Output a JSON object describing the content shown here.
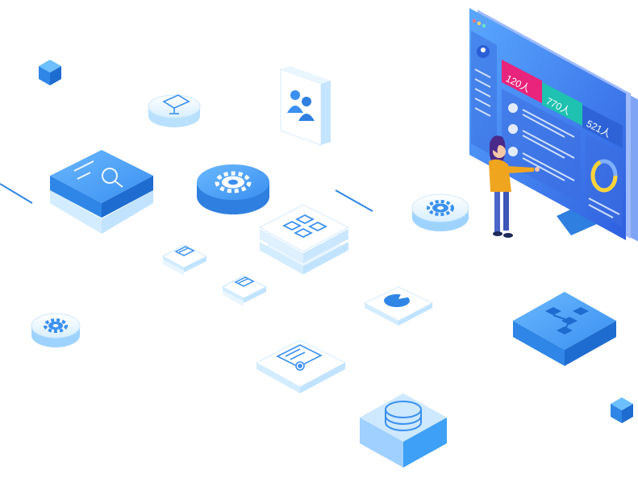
{
  "dashboard": {
    "stat_cards": [
      {
        "value": "120人",
        "color": "#e8247c"
      },
      {
        "value": "770人",
        "color": "#1fc1b0"
      },
      {
        "value": "521人",
        "color": "#2e63d8"
      }
    ],
    "ring_fill": 0.7
  },
  "palette": {
    "primary": "#3a8ff0",
    "primary_dark": "#1f6fd6",
    "light": "#dff2ff",
    "ice": "#eaf6ff",
    "monitor": "#4d82ee"
  },
  "icons": {
    "monitor": "monitor-icon",
    "users": "users-icon",
    "gear": "gear-icon",
    "search": "search-settings-icon",
    "grid": "grid-icon",
    "pie": "pie-chart-icon",
    "document": "document-settings-icon",
    "database": "database-icon",
    "flowchart": "flowchart-icon",
    "chip": "chip-icon",
    "cube": "cube-icon"
  }
}
